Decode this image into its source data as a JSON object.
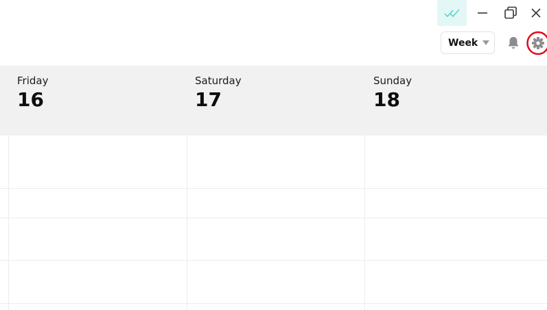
{
  "window_controls": {
    "sync_icon": "double-check-icon",
    "minimize_icon": "minimize-icon",
    "restore_icon": "restore-icon",
    "close_icon": "close-icon",
    "sync_bg_color": "#e3f7f6",
    "sync_icon_color": "#4dd0c8"
  },
  "toolbar": {
    "view_select": {
      "value": "Week",
      "icon": "chevron-down-icon"
    },
    "notifications_icon": "bell-icon",
    "settings_icon": "gear-icon",
    "highlight_color": "#e3061b"
  },
  "week": {
    "days": [
      {
        "name": "Friday",
        "date": "16"
      },
      {
        "name": "Saturday",
        "date": "17"
      },
      {
        "name": "Sunday",
        "date": "18"
      }
    ]
  },
  "colors": {
    "header_bg": "#f1f1f1",
    "grid_line": "#ececec"
  }
}
